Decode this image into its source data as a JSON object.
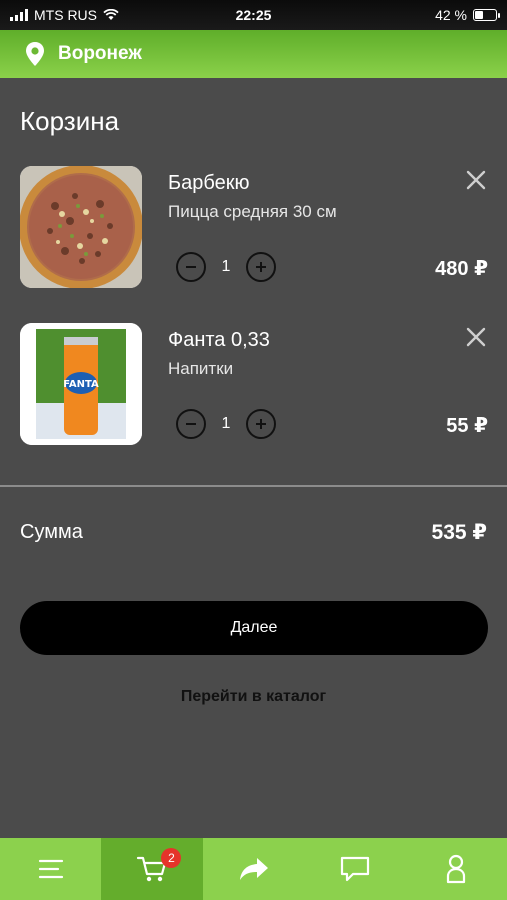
{
  "status_bar": {
    "carrier": "MTS RUS",
    "time": "22:25",
    "battery": "42 %",
    "battery_level": 0.42
  },
  "header": {
    "city": "Воронеж",
    "icon": "location-pin-icon"
  },
  "cart": {
    "title": "Корзина",
    "items": [
      {
        "name": "Барбекю",
        "category": "Пицца средняя 30 см",
        "quantity": "1",
        "price": "480 ₽"
      },
      {
        "name": "Фанта 0,33",
        "category": "Напитки",
        "quantity": "1",
        "price": "55 ₽"
      }
    ],
    "sum_label": "Сумма",
    "sum_value": "535 ₽",
    "next_label": "Далее",
    "catalog_label": "Перейти в каталог"
  },
  "tabbar": {
    "tabs": [
      {
        "icon": "menu-icon"
      },
      {
        "icon": "cart-icon",
        "badge": "2",
        "active": true
      },
      {
        "icon": "share-arrow-icon"
      },
      {
        "icon": "chat-icon"
      },
      {
        "icon": "profile-icon"
      }
    ]
  },
  "colors": {
    "accent_green": "#8cd14d",
    "active_tab": "#64ad2c",
    "background": "#4b4b4b",
    "badge_red": "#e5342a"
  }
}
